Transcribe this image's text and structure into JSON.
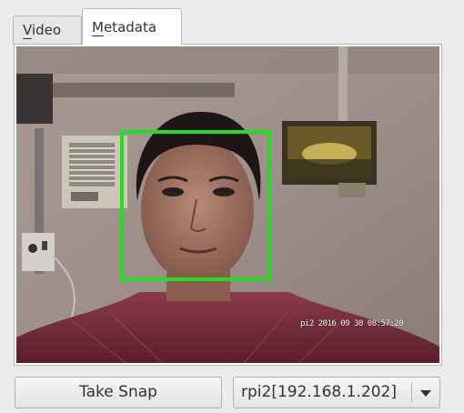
{
  "tabs": [
    {
      "label": "Video",
      "mnemonic": "V",
      "rest": "ideo",
      "selected": false
    },
    {
      "label": "Metadata",
      "mnemonic": "M",
      "rest": "etadata",
      "selected": true
    }
  ],
  "video": {
    "overlay_timestamp": "pi2 2016 09 30 08:57:20",
    "face_box_color": "#22dd22"
  },
  "controls": {
    "snap_label": "Take Snap",
    "camera_select": "rpi2[192.168.1.202]"
  }
}
